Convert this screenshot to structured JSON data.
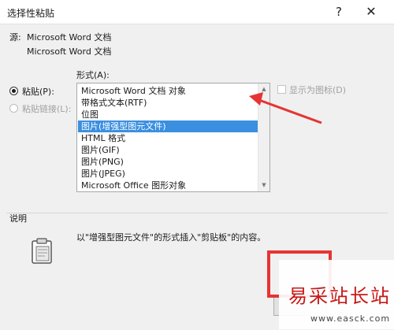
{
  "window": {
    "title": "选择性粘贴",
    "help_label": "?",
    "close_label": "✕"
  },
  "source": {
    "label": "源:",
    "line1": "Microsoft Word 文档",
    "line2": "Microsoft Word 文档"
  },
  "format": {
    "label": "形式(A):",
    "items": [
      "Microsoft Word 文档 对象",
      "带格式文本(RTF)",
      "位图",
      "图片(增强型图元文件)",
      "HTML 格式",
      "图片(GIF)",
      "图片(PNG)",
      "图片(JPEG)",
      "Microsoft Office 图形对象"
    ],
    "selected_index": 3
  },
  "options": {
    "paste_label": "粘贴(P):",
    "paste_link_label": "粘贴链接(L):",
    "display_as_icon_label": "显示为图标(D)"
  },
  "description": {
    "label": "说明",
    "text": "以\"增强型图元文件\"的形式插入\"剪贴板\"的内容。"
  },
  "watermark": {
    "text": "易采站长站",
    "url": "www.easck.com"
  },
  "colors": {
    "selection": "#3a8fe0",
    "annotation_red": "#e63434"
  },
  "icons": {
    "clipboard": "clipboard-icon",
    "scroll_up": "arrow-up-icon",
    "scroll_down": "arrow-down-icon"
  }
}
